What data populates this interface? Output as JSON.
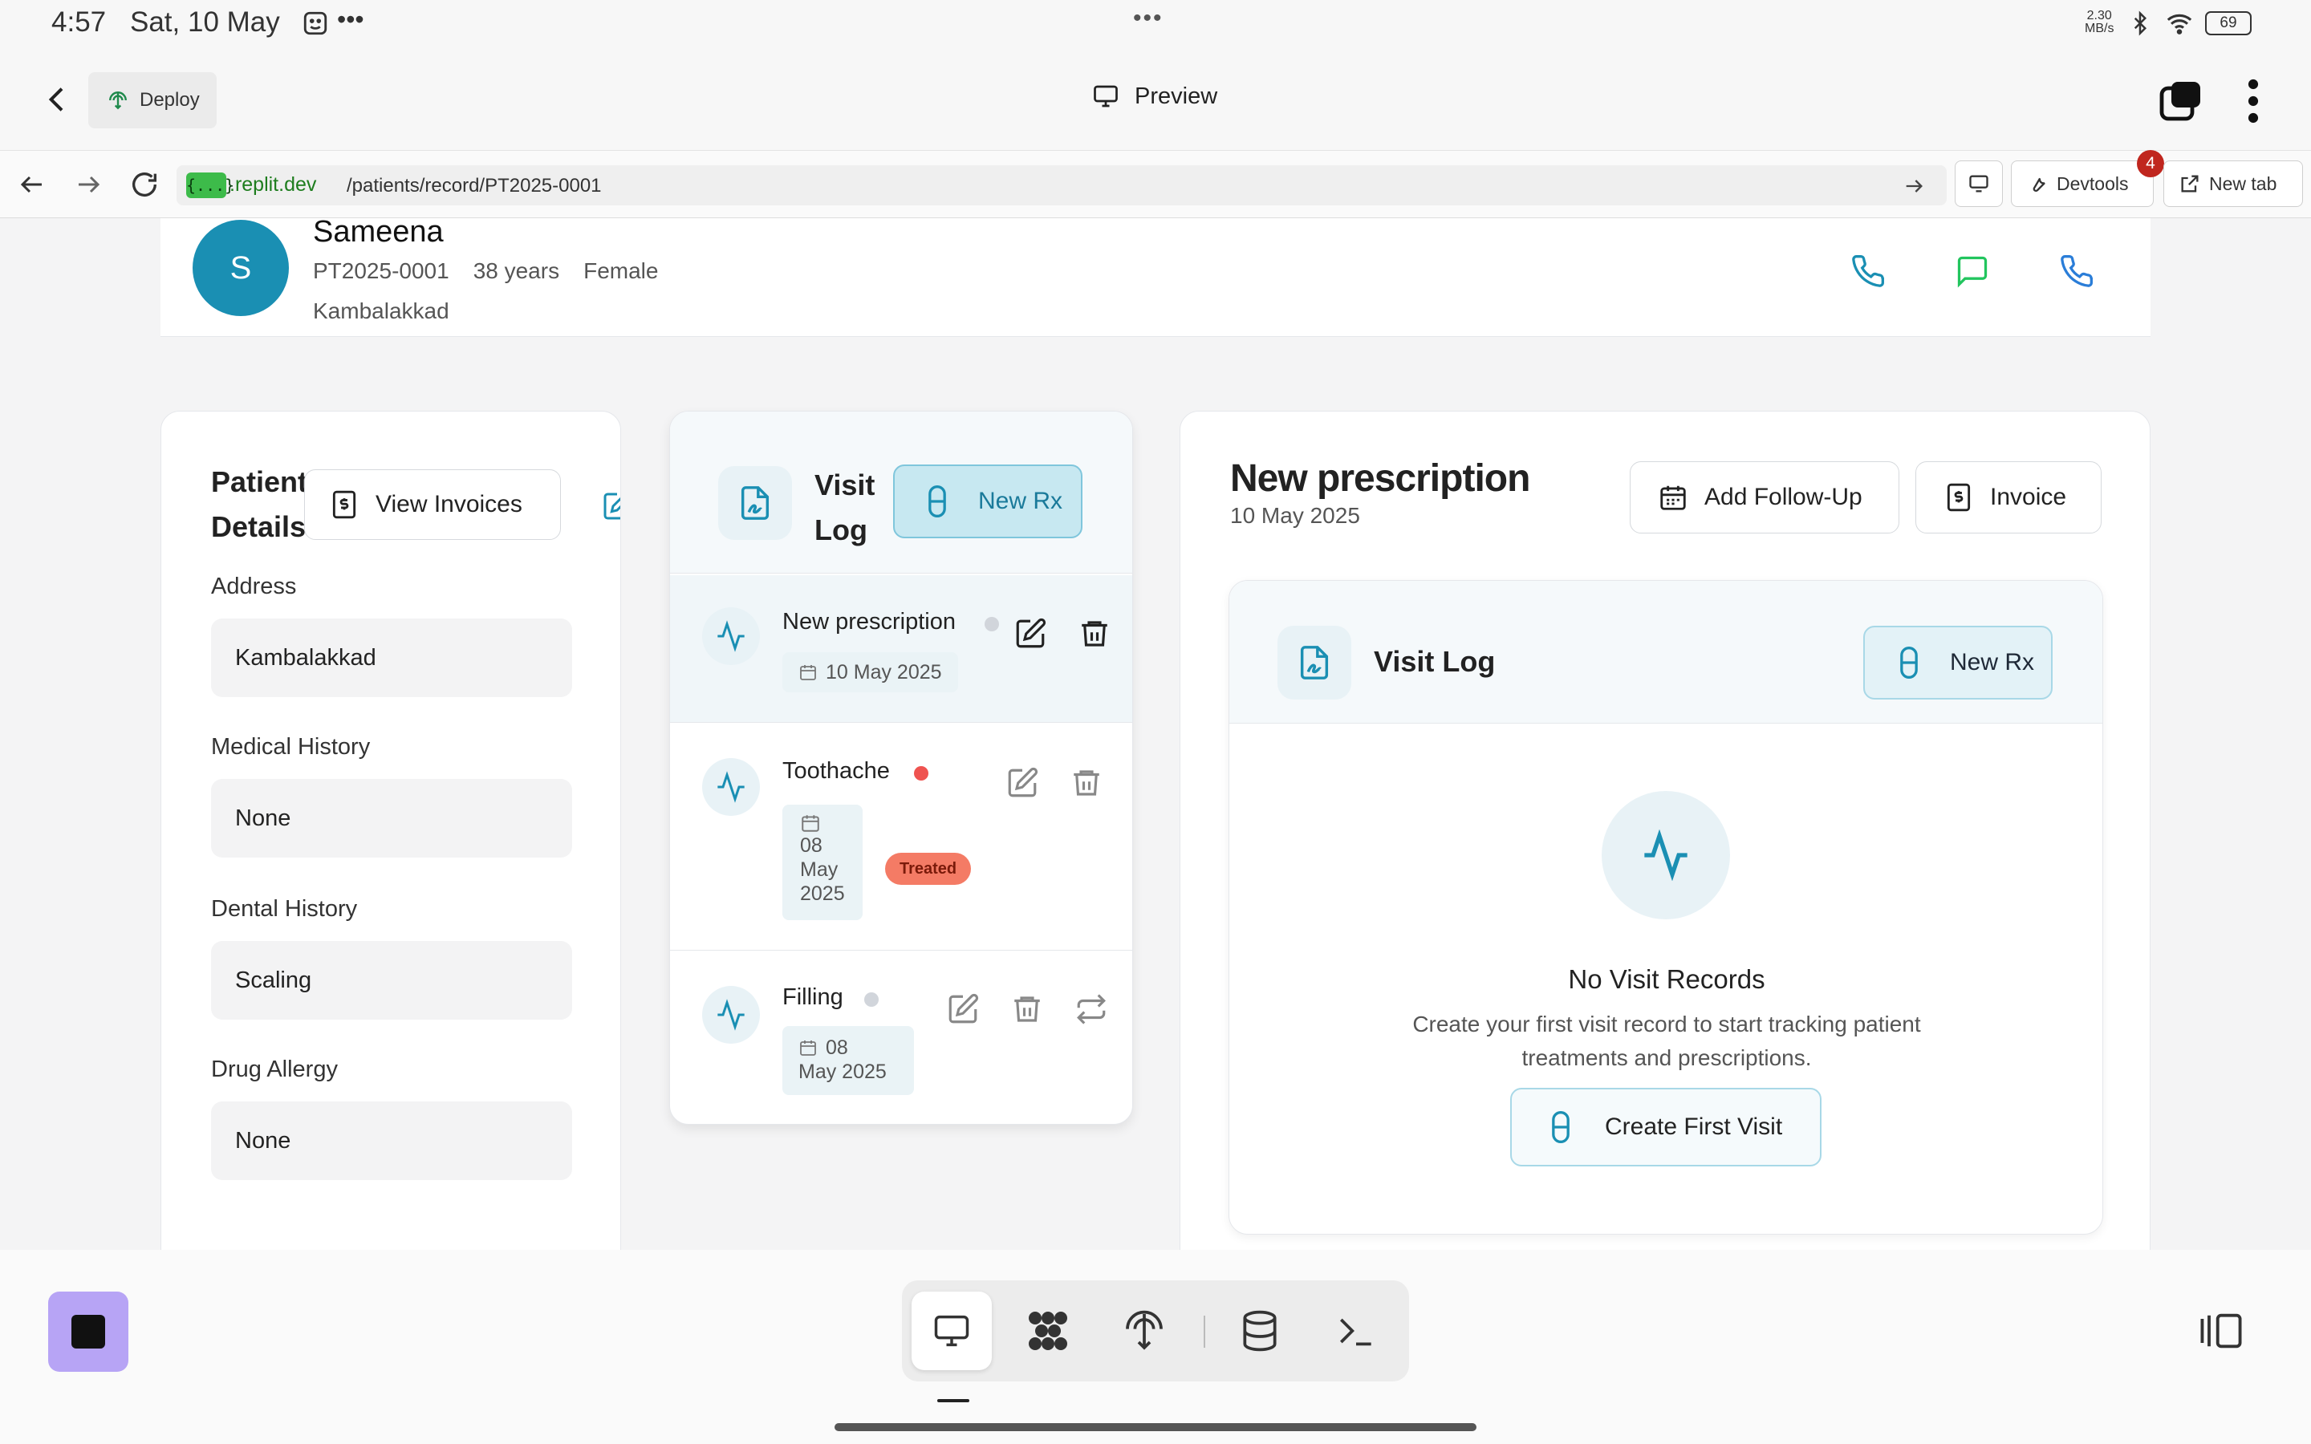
{
  "status_bar": {
    "time": "4:57",
    "date": "Sat, 10 May",
    "network_speed_top": "2.30",
    "network_speed_bottom": "MB/s",
    "battery": "69"
  },
  "app_header": {
    "deploy_label": "Deploy",
    "preview_label": "Preview"
  },
  "browser": {
    "url_badge": "{...}",
    "url_domain": ".replit.dev",
    "url_path": "/patients/record/PT2025-0001",
    "devtools_label": "Devtools",
    "devtools_badge": "4",
    "new_tab_label": "New tab"
  },
  "patient": {
    "avatar_initial": "S",
    "name": "Sameena",
    "id": "PT2025-0001",
    "age": "38 years",
    "gender": "Female",
    "location": "Kambalakkad"
  },
  "details": {
    "title_line1": "Patient",
    "title_line2": "Details",
    "view_invoices_label": "View Invoices",
    "edit_label_partial": "E",
    "fields": [
      {
        "label": "Address",
        "value": "Kambalakkad"
      },
      {
        "label": "Medical History",
        "value": "None"
      },
      {
        "label": "Dental History",
        "value": "Scaling"
      },
      {
        "label": "Drug Allergy",
        "value": "None"
      }
    ]
  },
  "visit_log_panel": {
    "title_line1": "Visit",
    "title_line2": "Log",
    "new_rx_label": "New Rx",
    "visits": [
      {
        "title": "New prescription",
        "date": "10 May 2025",
        "status_color": "#d1d5db"
      },
      {
        "title": "Toothache",
        "date_lines": [
          "08",
          "May",
          "2025"
        ],
        "status_color": "#ef5350",
        "badge": "Treated"
      },
      {
        "title": "Filling",
        "date_lines": [
          "08",
          "May 2025"
        ],
        "status_color": "#d1d5db"
      }
    ]
  },
  "prescription": {
    "title": "New prescription",
    "date": "10 May 2025",
    "add_follow_up_label": "Add Follow-Up",
    "invoice_label": "Invoice",
    "inner_visit_log_title": "Visit Log",
    "inner_new_rx_label": "New Rx",
    "empty_title": "No Visit Records",
    "empty_line1": "Create your first visit record to start tracking patient",
    "empty_line2": "treatments and prescriptions.",
    "create_first_visit_label": "Create First Visit"
  },
  "colors": {
    "accent": "#1a8fb3",
    "accent_light": "#e8f2f6",
    "green_icon": "#22c55e",
    "treated_badge": "#f47b65",
    "dock_app": "#b7a4f5"
  },
  "icons": [
    "back-arrow-icon",
    "deploy-icon",
    "monitor-icon",
    "overview-icon",
    "kebab-menu-icon",
    "phone-icon",
    "message-icon",
    "receipt-icon",
    "edit-icon",
    "file-signature-icon",
    "pill-icon",
    "activity-icon",
    "trash-icon",
    "calendar-icon",
    "repeat-icon",
    "database-icon",
    "terminal-icon",
    "shell-icon"
  ]
}
